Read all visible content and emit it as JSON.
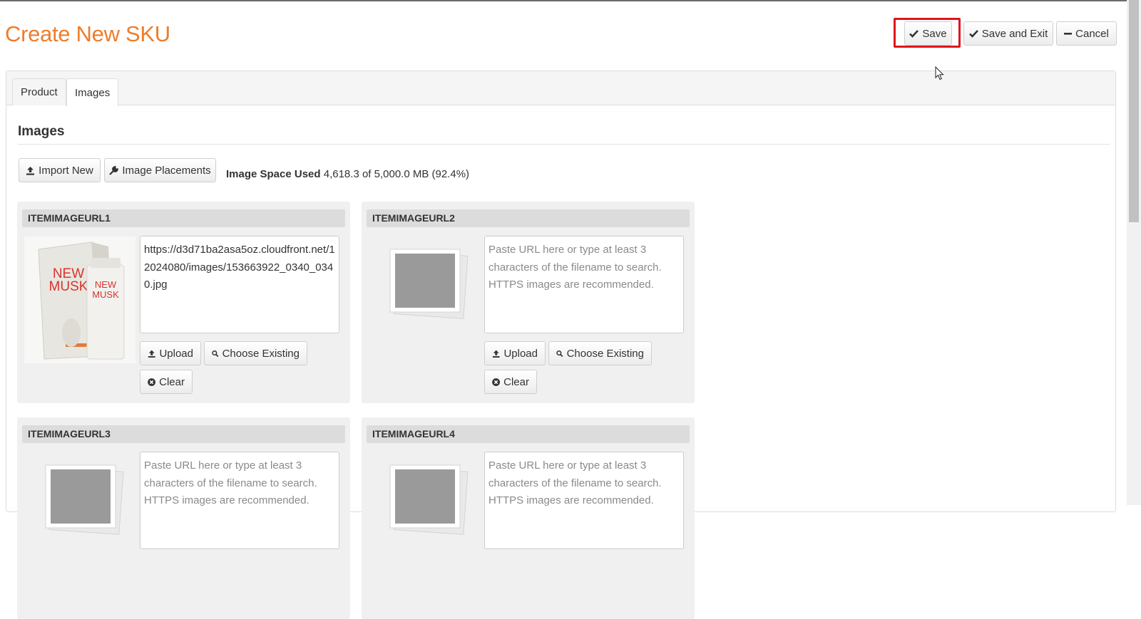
{
  "page": {
    "title": "Create New SKU"
  },
  "toolbar": {
    "save_label": "Save",
    "save_exit_label": "Save and Exit",
    "cancel_label": "Cancel"
  },
  "tabs": [
    {
      "label": "Product",
      "active": false
    },
    {
      "label": "Images",
      "active": true
    }
  ],
  "images_section": {
    "title": "Images",
    "import_label": "Import New",
    "placements_label": "Image Placements",
    "space_label": "Image Space Used",
    "space_value": "4,618.3 of 5,000.0 MB (92.4%)"
  },
  "cards": [
    {
      "header": "ITEMIMAGEURL1",
      "url": "https://d3d71ba2asa5oz.cloudfront.net/12024080/images/153663922_0340_0340.jpg",
      "placeholder": "",
      "upload_label": "Upload",
      "choose_label": "Choose Existing",
      "clear_label": "Clear",
      "thumb": "product-photo"
    },
    {
      "header": "ITEMIMAGEURL2",
      "url": "",
      "placeholder": "Paste URL here or type at least 3 characters of the filename to search. HTTPS images are recommended.",
      "upload_label": "Upload",
      "choose_label": "Choose Existing",
      "clear_label": "Clear",
      "thumb": "placeholder-image"
    },
    {
      "header": "ITEMIMAGEURL3",
      "url": "",
      "placeholder": "Paste URL here or type at least 3 characters of the filename to search. HTTPS images are recommended.",
      "upload_label": "Upload",
      "choose_label": "Choose Existing",
      "clear_label": "Clear",
      "thumb": "placeholder-image"
    },
    {
      "header": "ITEMIMAGEURL4",
      "url": "",
      "placeholder": "Paste URL here or type at least 3 characters of the filename to search. HTTPS images are recommended.",
      "upload_label": "Upload",
      "choose_label": "Choose Existing",
      "clear_label": "Clear",
      "thumb": "placeholder-image"
    }
  ],
  "product_image": {
    "brand_text": "NEW MUSK",
    "box_text": "NEW MUSK"
  },
  "colors": {
    "title": "#ee7d2b",
    "highlight": "#e0141e",
    "card_bg": "#f0f0f0",
    "header_bg": "#dcdcdc"
  },
  "icons": {
    "save": "check-icon",
    "cancel": "minus-icon",
    "import": "upload-icon",
    "placements": "wrench-icon",
    "upload": "upload-icon",
    "choose": "search-icon",
    "clear": "times-circle-icon"
  }
}
